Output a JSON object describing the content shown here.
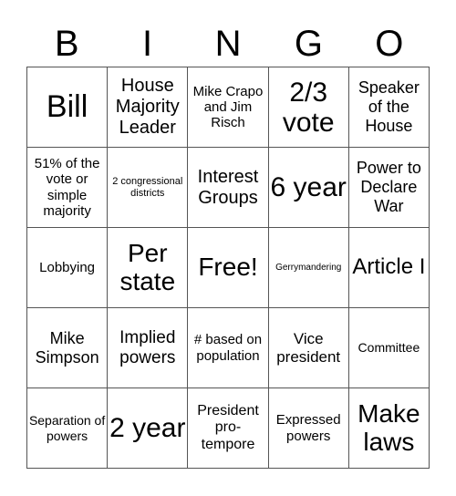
{
  "header": {
    "letters": [
      "B",
      "I",
      "N",
      "G",
      "O"
    ]
  },
  "cells": [
    "Bill",
    "House Majority Leader",
    "Mike Crapo and Jim Risch",
    "2/3 vote",
    "Speaker of the House",
    "51% of the vote or simple majority",
    "2 congressional districts",
    "Interest Groups",
    "6 year",
    "Power to Declare War",
    "Lobbying",
    "Per state",
    "Free!",
    "Gerrymandering",
    "Article I",
    "Mike Simpson",
    "Implied powers",
    "# based on population",
    "Vice president",
    "Committee",
    "Separation of powers",
    "2 year",
    "President pro-tempore",
    "Expressed powers",
    "Make laws"
  ]
}
